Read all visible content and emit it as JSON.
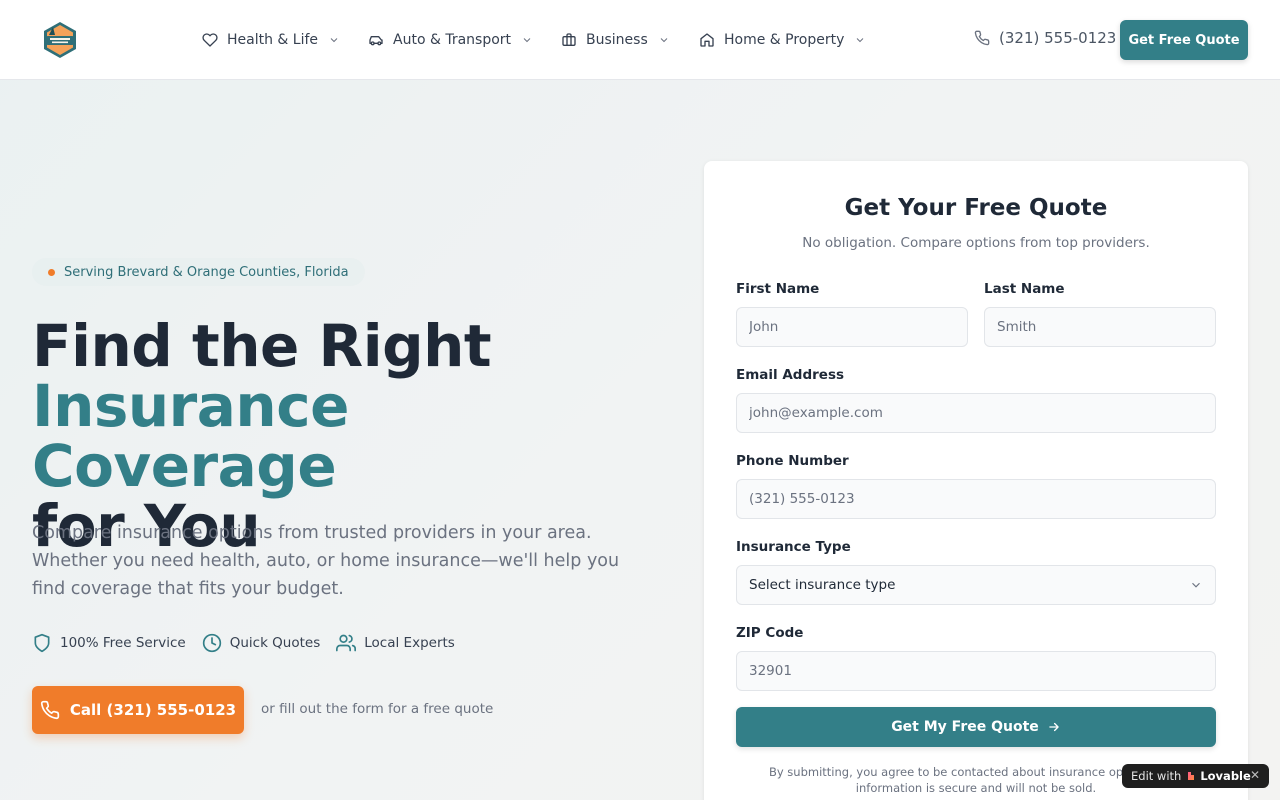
{
  "header": {
    "nav": [
      {
        "label": "Health & Life",
        "icon": "heart-icon"
      },
      {
        "label": "Auto & Transport",
        "icon": "car-icon"
      },
      {
        "label": "Business",
        "icon": "briefcase-icon"
      },
      {
        "label": "Home & Property",
        "icon": "home-icon"
      }
    ],
    "phone": "(321) 555-0123",
    "cta": "Get Free Quote"
  },
  "hero": {
    "badge": "Serving Brevard & Orange Counties, Florida",
    "title_line1": "Find the Right",
    "title_line2": "Insurance Coverage",
    "title_line3": "for You",
    "subtitle": "Compare insurance options from trusted providers in your area. Whether you need health, auto, or home insurance—we'll help you find coverage that fits your budget.",
    "features": [
      "100% Free Service",
      "Quick Quotes",
      "Local Experts"
    ],
    "call_button": "Call (321) 555-0123",
    "or_text": "or fill out the form for a free quote"
  },
  "form": {
    "title": "Get Your Free Quote",
    "subtitle": "No obligation. Compare options from top providers.",
    "first_name": {
      "label": "First Name",
      "placeholder": "John"
    },
    "last_name": {
      "label": "Last Name",
      "placeholder": "Smith"
    },
    "email": {
      "label": "Email Address",
      "placeholder": "john@example.com"
    },
    "phone": {
      "label": "Phone Number",
      "placeholder": "(321) 555-0123"
    },
    "insurance_type": {
      "label": "Insurance Type",
      "value": "Select insurance type"
    },
    "zip": {
      "label": "ZIP Code",
      "placeholder": "32901"
    },
    "submit": "Get My Free Quote",
    "disclaimer": "By submitting, you agree to be contacted about insurance options. Your information is secure and will not be sold."
  },
  "lovable": {
    "edit_text": "Edit with",
    "brand": "Lovable",
    "close": "✕"
  },
  "colors": {
    "teal": "#337f88",
    "orange": "#f07c2a",
    "dark": "#1f2937"
  }
}
